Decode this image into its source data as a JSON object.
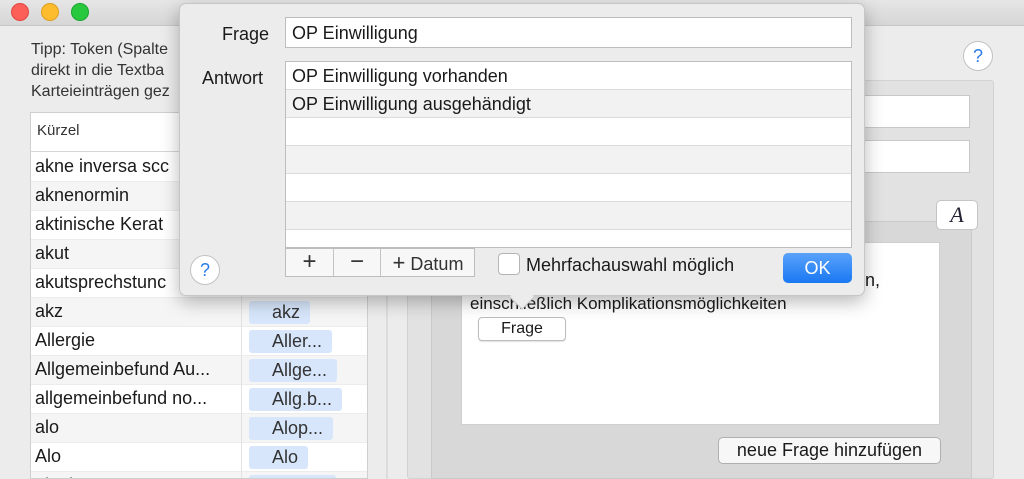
{
  "tip": {
    "lines": [
      "Tipp: Token (Spalte",
      "direkt in die Textba",
      "Karteieinträgen gez"
    ]
  },
  "table": {
    "header": "Kürzel",
    "rows": [
      {
        "label": "akne inversa scc",
        "token": ""
      },
      {
        "label": "aknenormin",
        "token": ""
      },
      {
        "label": "aktinische Kerat",
        "token": ""
      },
      {
        "label": "akut",
        "token": ""
      },
      {
        "label": "akutsprechstunc",
        "token": ""
      },
      {
        "label": "akz",
        "token": "akz"
      },
      {
        "label": "Allergie",
        "token": "Aller..."
      },
      {
        "label": "Allgemeinbefund Au...",
        "token": "Allge..."
      },
      {
        "label": "allgemeinbefund no...",
        "token": "Allg.b..."
      },
      {
        "label": "alo",
        "token": "Alop..."
      },
      {
        "label": "Alo",
        "token": "Alo"
      },
      {
        "label": "alopho",
        "token": "alopho"
      }
    ]
  },
  "editor": {
    "line1_tail": "n,",
    "line2": "einschließlich Komplikationsmöglichkeiten",
    "chip": "Frage"
  },
  "buttons": {
    "new_question": "neue Frage hinzufügen",
    "format": "A",
    "help": "?"
  },
  "popover": {
    "frage_label": "Frage",
    "frage_value": "OP Einwilligung",
    "antwort_label": "Antwort",
    "answers": [
      "OP Einwilligung vorhanden",
      "OP Einwilligung ausgehändigt",
      "",
      "",
      "",
      "",
      ""
    ],
    "add": "+",
    "remove": "−",
    "datum_plus": "+",
    "datum": "Datum",
    "multi_label": "Mehrfachauswahl möglich",
    "ok": "OK",
    "help": "?"
  },
  "colors": {
    "accent": "#1978f2",
    "token_bg": "#d7e6fb"
  }
}
